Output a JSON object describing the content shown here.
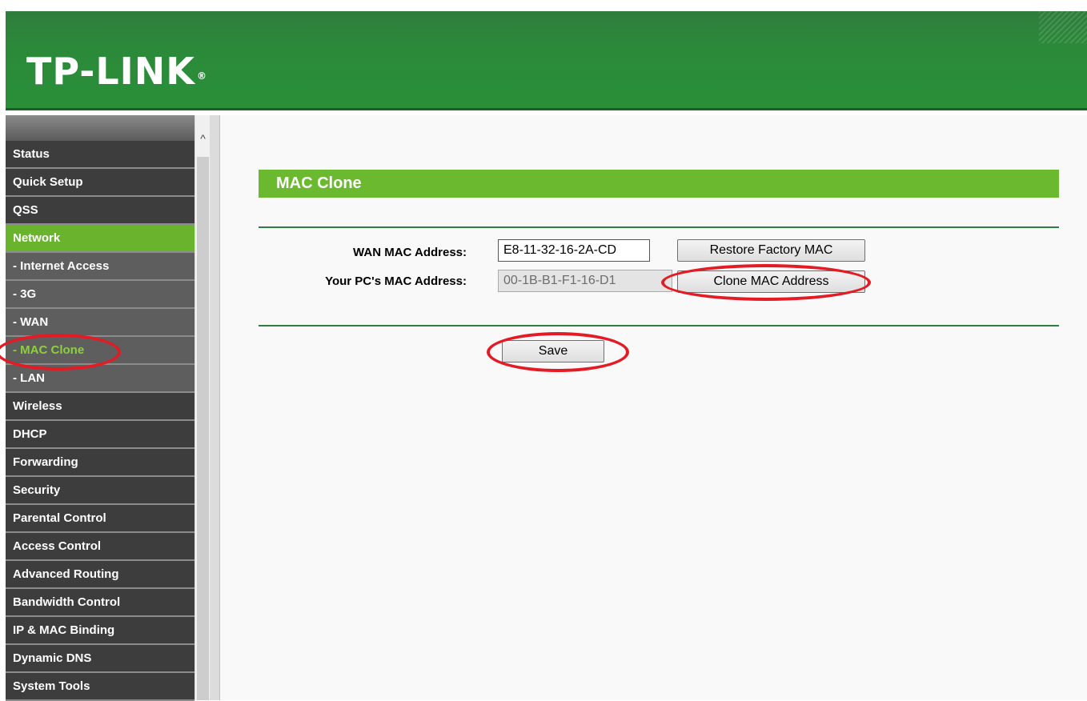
{
  "header": {
    "logo_text": "TP-LINK",
    "logo_mark": "®"
  },
  "sidebar": {
    "items": [
      {
        "label": "Status"
      },
      {
        "label": "Quick Setup"
      },
      {
        "label": "QSS"
      },
      {
        "label": "Network"
      },
      {
        "label": "- Internet Access"
      },
      {
        "label": "- 3G"
      },
      {
        "label": "- WAN"
      },
      {
        "label": "- MAC Clone"
      },
      {
        "label": "- LAN"
      },
      {
        "label": "Wireless"
      },
      {
        "label": "DHCP"
      },
      {
        "label": "Forwarding"
      },
      {
        "label": "Security"
      },
      {
        "label": "Parental Control"
      },
      {
        "label": "Access Control"
      },
      {
        "label": "Advanced Routing"
      },
      {
        "label": "Bandwidth Control"
      },
      {
        "label": "IP & MAC Binding"
      },
      {
        "label": "Dynamic DNS"
      },
      {
        "label": "System Tools"
      }
    ]
  },
  "scrollbar": {
    "up_arrow": "^"
  },
  "main": {
    "section_title": "MAC Clone",
    "wan_mac_label": "WAN MAC Address:",
    "wan_mac_value": "E8-11-32-16-2A-CD",
    "restore_button": "Restore Factory MAC",
    "pc_mac_label": "Your PC's MAC Address:",
    "pc_mac_value": "00-1B-B1-F1-16-D1",
    "clone_button": "Clone MAC Address",
    "save_button": "Save"
  },
  "colors": {
    "header_green": "#2b8a3a",
    "accent_green": "#6ab92e",
    "highlight_red": "#e21b24",
    "active_text_green": "#8cd13a"
  }
}
